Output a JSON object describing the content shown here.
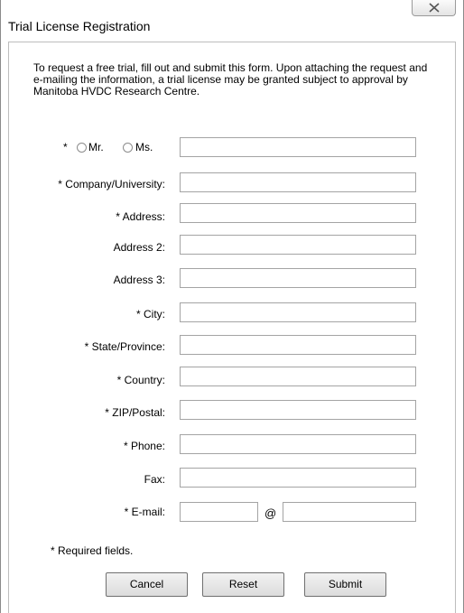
{
  "window": {
    "title": "Trial License Registration"
  },
  "intro": "To request a free trial, fill out and submit this form. Upon attaching the request and e-mailing the information, a trial license may be granted subject to approval by Manitoba HVDC Research Centre.",
  "salutation": {
    "asterisk": "*",
    "mr_label": "Mr.",
    "ms_label": "Ms."
  },
  "fields": {
    "company": {
      "label": "* Company/University:",
      "value": ""
    },
    "address": {
      "label": "* Address:",
      "value": ""
    },
    "address2": {
      "label": "Address 2:",
      "value": ""
    },
    "address3": {
      "label": "Address 3:",
      "value": ""
    },
    "city": {
      "label": "* City:",
      "value": ""
    },
    "state": {
      "label": "* State/Province:",
      "value": ""
    },
    "country": {
      "label": "* Country:",
      "value": ""
    },
    "zip": {
      "label": "* ZIP/Postal:",
      "value": ""
    },
    "phone": {
      "label": "* Phone:",
      "value": ""
    },
    "fax": {
      "label": "Fax:",
      "value": ""
    },
    "email": {
      "label": "* E-mail:",
      "user": "",
      "at": "@",
      "domain": ""
    }
  },
  "name_value": "",
  "required_note": "* Required fields.",
  "buttons": {
    "cancel": "Cancel",
    "reset": "Reset",
    "submit": "Submit"
  }
}
